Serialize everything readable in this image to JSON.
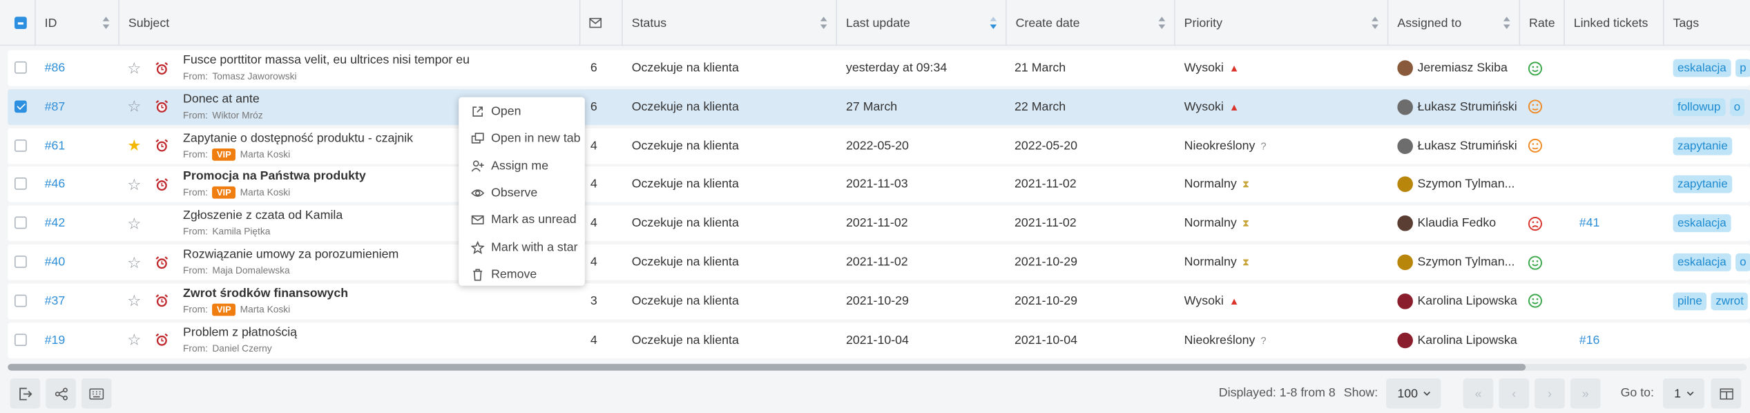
{
  "header": {
    "id": "ID",
    "subject": "Subject",
    "status": "Status",
    "last_update": "Last update",
    "create_date": "Create date",
    "priority": "Priority",
    "assigned_to": "Assigned to",
    "rate": "Rate",
    "linked": "Linked tickets",
    "tags": "Tags"
  },
  "rows": [
    {
      "id": "#86",
      "starred": false,
      "alarm": true,
      "subject": "Fusce porttitor massa velit, eu ultrices nisi tempor eu",
      "bold": false,
      "from_label": "From:",
      "vip": false,
      "from": "Tomasz Jaworowski",
      "messages": "6",
      "status": "Oczekuje na klienta",
      "last_update": "yesterday at 09:34",
      "create_date": "21 March",
      "priority": "Wysoki",
      "priority_level": "high",
      "assignee": "Jeremiasz Skiba",
      "rate": "happy",
      "linked": "",
      "tags": [
        "eskalacja",
        "p"
      ],
      "selected": false
    },
    {
      "id": "#87",
      "starred": false,
      "alarm": true,
      "subject": "Donec at ante",
      "bold": false,
      "from_label": "From:",
      "vip": false,
      "from": "Wiktor Mróz",
      "messages": "6",
      "status": "Oczekuje na klienta",
      "last_update": "27 March",
      "create_date": "22 March",
      "priority": "Wysoki",
      "priority_level": "high",
      "assignee": "Łukasz Strumiński",
      "rate": "neutral",
      "linked": "",
      "tags": [
        "followup",
        "o"
      ],
      "selected": true
    },
    {
      "id": "#61",
      "starred": true,
      "alarm": true,
      "subject": "Zapytanie o dostępność produktu - czajnik",
      "bold": false,
      "from_label": "From:",
      "vip": true,
      "vip_label": "VIP",
      "from": "Marta Koski",
      "messages": "4",
      "status": "Oczekuje na klienta",
      "last_update": "2022-05-20",
      "create_date": "2022-05-20",
      "priority": "Nieokreślony",
      "priority_level": "unknown",
      "assignee": "Łukasz Strumiński",
      "rate": "neutral",
      "linked": "",
      "tags": [
        "zapytanie"
      ],
      "selected": false
    },
    {
      "id": "#46",
      "starred": false,
      "alarm": true,
      "subject": "Promocja na Państwa produkty",
      "bold": true,
      "from_label": "From:",
      "vip": true,
      "vip_label": "VIP",
      "from": "Marta Koski",
      "messages": "4",
      "status": "Oczekuje na klienta",
      "last_update": "2021-11-03",
      "create_date": "2021-11-02",
      "priority": "Normalny",
      "priority_level": "normal",
      "assignee": "Szymon Tylman...",
      "rate": "",
      "linked": "",
      "tags": [
        "zapytanie"
      ],
      "selected": false
    },
    {
      "id": "#42",
      "starred": false,
      "alarm": false,
      "subject": "Zgłoszenie z czata od Kamila",
      "bold": false,
      "from_label": "From:",
      "vip": false,
      "from": "Kamila Piętka",
      "messages": "4",
      "status": "Oczekuje na klienta",
      "last_update": "2021-11-02",
      "create_date": "2021-11-02",
      "priority": "Normalny",
      "priority_level": "normal",
      "assignee": "Klaudia Fedko",
      "rate": "sad",
      "linked": "#41",
      "tags": [
        "eskalacja"
      ],
      "selected": false
    },
    {
      "id": "#40",
      "starred": false,
      "alarm": true,
      "subject": "Rozwiązanie umowy za porozumieniem",
      "bold": false,
      "from_label": "From:",
      "vip": false,
      "from": "Maja Domalewska",
      "messages": "4",
      "status": "Oczekuje na klienta",
      "last_update": "2021-11-02",
      "create_date": "2021-10-29",
      "priority": "Normalny",
      "priority_level": "normal",
      "assignee": "Szymon Tylman...",
      "rate": "happy",
      "linked": "",
      "tags": [
        "eskalacja",
        "o"
      ],
      "selected": false
    },
    {
      "id": "#37",
      "starred": false,
      "alarm": true,
      "subject": "Zwrot środków finansowych",
      "bold": true,
      "from_label": "From:",
      "vip": true,
      "vip_label": "VIP",
      "from": "Marta Koski",
      "messages": "3",
      "status": "Oczekuje na klienta",
      "last_update": "2021-10-29",
      "create_date": "2021-10-29",
      "priority": "Wysoki",
      "priority_level": "high",
      "assignee": "Karolina Lipowska",
      "rate": "happy",
      "linked": "",
      "tags": [
        "pilne",
        "zwrot"
      ],
      "selected": false
    },
    {
      "id": "#19",
      "starred": false,
      "alarm": true,
      "subject": "Problem z płatnością",
      "bold": false,
      "from_label": "From:",
      "vip": false,
      "from": "Daniel Czerny",
      "messages": "4",
      "status": "Oczekuje na klienta",
      "last_update": "2021-10-04",
      "create_date": "2021-10-04",
      "priority": "Nieokreślony",
      "priority_level": "unknown",
      "assignee": "Karolina Lipowska",
      "rate": "",
      "linked": "#16",
      "tags": [],
      "selected": false
    }
  ],
  "context_menu": {
    "items": [
      {
        "label": "Open",
        "icon": "external-link-icon"
      },
      {
        "label": "Open in new tab",
        "icon": "new-tab-icon"
      },
      {
        "label": "Assign me",
        "icon": "user-plus-icon"
      },
      {
        "label": "Observe",
        "icon": "eye-icon"
      },
      {
        "label": "Mark as unread",
        "icon": "envelope-icon"
      },
      {
        "label": "Mark with a star",
        "icon": "star-icon"
      },
      {
        "label": "Remove",
        "icon": "trash-icon"
      }
    ]
  },
  "footer": {
    "displayed": "Displayed: 1-8 from 8",
    "show_label": "Show:",
    "show_value": "100",
    "goto_label": "Go to:",
    "goto_value": "1"
  },
  "colors": {
    "accent": "#2f8fd8",
    "selected_row": "#d9e9f6",
    "vip": "#f07d0f",
    "tag_bg": "#bfe4f7",
    "alarm": "#c0282d"
  }
}
